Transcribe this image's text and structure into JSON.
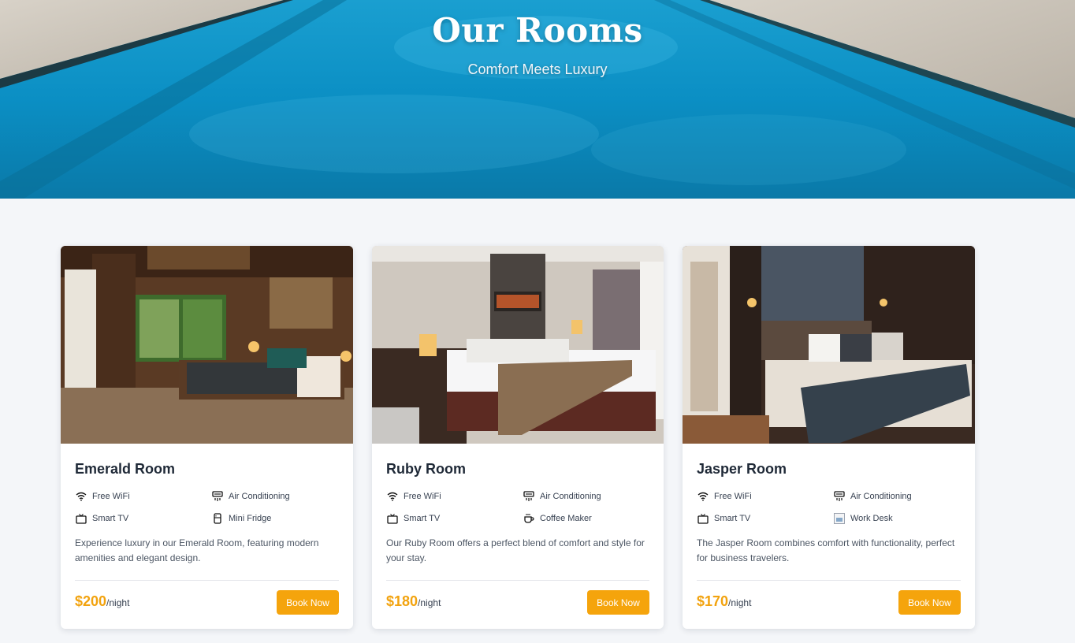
{
  "hero": {
    "title": "Our Rooms",
    "subtitle": "Comfort Meets Luxury"
  },
  "rooms": [
    {
      "name": "Emerald Room",
      "amenities": [
        {
          "icon": "wifi-icon",
          "label": "Free WiFi"
        },
        {
          "icon": "air-conditioning-icon",
          "label": "Air Conditioning"
        },
        {
          "icon": "tv-icon",
          "label": "Smart TV"
        },
        {
          "icon": "mini-fridge-icon",
          "label": "Mini Fridge"
        }
      ],
      "description": "Experience luxury in our Emerald Room, featuring modern amenities and elegant design.",
      "price": "$200",
      "per": "/night",
      "button": "Book Now"
    },
    {
      "name": "Ruby Room",
      "amenities": [
        {
          "icon": "wifi-icon",
          "label": "Free WiFi"
        },
        {
          "icon": "air-conditioning-icon",
          "label": "Air Conditioning"
        },
        {
          "icon": "tv-icon",
          "label": "Smart TV"
        },
        {
          "icon": "coffee-icon",
          "label": "Coffee Maker"
        }
      ],
      "description": "Our Ruby Room offers a perfect blend of comfort and style for your stay.",
      "price": "$180",
      "per": "/night",
      "button": "Book Now"
    },
    {
      "name": "Jasper Room",
      "amenities": [
        {
          "icon": "wifi-icon",
          "label": "Free WiFi"
        },
        {
          "icon": "air-conditioning-icon",
          "label": "Air Conditioning"
        },
        {
          "icon": "tv-icon",
          "label": "Smart TV"
        },
        {
          "icon": "broken-image-icon",
          "label": "Work Desk"
        }
      ],
      "description": "The Jasper Room combines comfort with functionality, perfect for business travelers.",
      "price": "$170",
      "per": "/night",
      "button": "Book Now"
    }
  ],
  "colors": {
    "accent": "#f5a40c",
    "price": "#f2a30f",
    "page_bg": "#f4f6f9",
    "pool": "#0b86b8"
  }
}
